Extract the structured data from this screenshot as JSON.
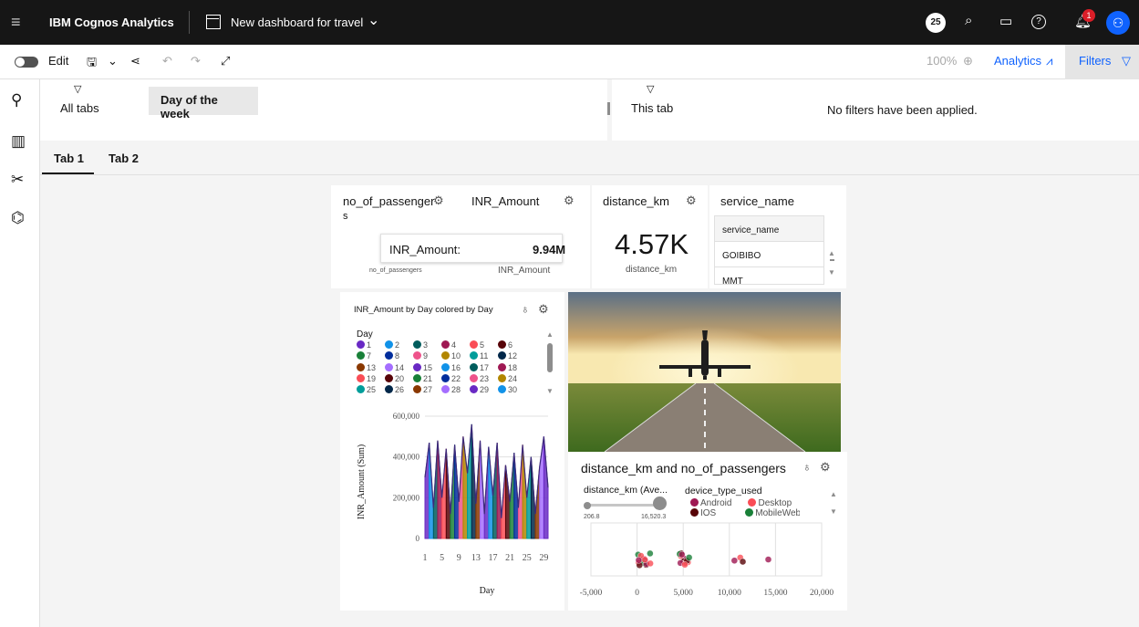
{
  "app": {
    "name": "IBM Cognos Analytics",
    "dashboard_title": "New dashboard for travel",
    "count_badge": "25",
    "notification_count": "1"
  },
  "toolbar": {
    "edit_label": "Edit",
    "zoom": "100%",
    "analytics_label": "Analytics",
    "filters_label": "Filters"
  },
  "filters": {
    "all_tabs_label": "All tabs",
    "chip_label": "Day of the week",
    "this_tab_label": "This tab",
    "empty_message": "No filters have been applied."
  },
  "tabs": [
    {
      "label": "Tab 1"
    },
    {
      "label": "Tab 2"
    }
  ],
  "widgets": {
    "passengers": {
      "title": "no_of_passenger",
      "title_wrap": "s",
      "caption": "no_of_passengers"
    },
    "inr": {
      "title": "INR_Amount",
      "caption": "INR_Amount"
    },
    "tooltip": {
      "label": "INR_Amount:",
      "value": "9.94M"
    },
    "distance": {
      "title": "distance_km",
      "value": "4.57K",
      "caption": "distance_km"
    },
    "service": {
      "title": "service_name",
      "rows": [
        "service_name",
        "GOIBIBO",
        "MMT"
      ]
    },
    "line_chart": {
      "title": "INR_Amount by Day colored by Day",
      "legend_title": "Day",
      "ylabel": "INR_Amount (Sum)",
      "xlabel": "Day",
      "yticks": [
        "600,000",
        "400,000",
        "200,000",
        "0"
      ],
      "xticks": [
        "1",
        "5",
        "9",
        "13",
        "17",
        "21",
        "25",
        "29"
      ]
    },
    "scatter": {
      "title": "distance_km and no_of_passengers",
      "slider_label": "distance_km (Ave...",
      "slider_min": "206.8",
      "slider_max": "16,520.3",
      "device_title": "device_type_used",
      "devices": [
        "Android",
        "Desktop",
        "IOS",
        "MobileWeb"
      ],
      "xticks": [
        "-5,000",
        "0",
        "5,000",
        "10,000",
        "15,000",
        "20,000"
      ]
    }
  },
  "chart_data": {
    "type": "line",
    "title": "INR_Amount by Day colored by Day",
    "xlabel": "Day",
    "ylabel": "INR_Amount (Sum)",
    "ylim": [
      0,
      600000
    ],
    "x": [
      1,
      2,
      3,
      4,
      5,
      6,
      7,
      8,
      9,
      10,
      11,
      12,
      13,
      14,
      15,
      16,
      17,
      18,
      19,
      20,
      21,
      22,
      23,
      24,
      25,
      26,
      27,
      28,
      29,
      30
    ],
    "values": [
      300000,
      470000,
      150000,
      480000,
      200000,
      440000,
      120000,
      460000,
      180000,
      500000,
      320000,
      560000,
      170000,
      480000,
      120000,
      450000,
      210000,
      470000,
      100000,
      360000,
      180000,
      420000,
      150000,
      460000,
      200000,
      400000,
      120000,
      350000,
      500000,
      250000
    ],
    "legend_days": [
      "1",
      "2",
      "3",
      "4",
      "5",
      "6",
      "7",
      "8",
      "9",
      "10",
      "11",
      "12",
      "13",
      "14",
      "15",
      "16",
      "17",
      "18",
      "19",
      "20",
      "21",
      "22",
      "23",
      "24",
      "25",
      "26",
      "27",
      "28",
      "29",
      "30"
    ],
    "colors": [
      "#6929c4",
      "#1192e8",
      "#005d5d",
      "#9f1853",
      "#fa4d56",
      "#570408",
      "#198038",
      "#002d9c",
      "#ee538b",
      "#b28600",
      "#009d9a",
      "#012749",
      "#8a3800",
      "#a56eff",
      "#6929c4",
      "#1192e8",
      "#005d5d",
      "#9f1853",
      "#fa4d56",
      "#570408",
      "#198038",
      "#002d9c",
      "#ee538b",
      "#b28600",
      "#009d9a",
      "#012749",
      "#8a3800",
      "#a56eff",
      "#6929c4",
      "#1192e8"
    ],
    "grid": true
  },
  "device_colors": [
    "#9f1853",
    "#fa4d56",
    "#570408",
    "#198038"
  ]
}
